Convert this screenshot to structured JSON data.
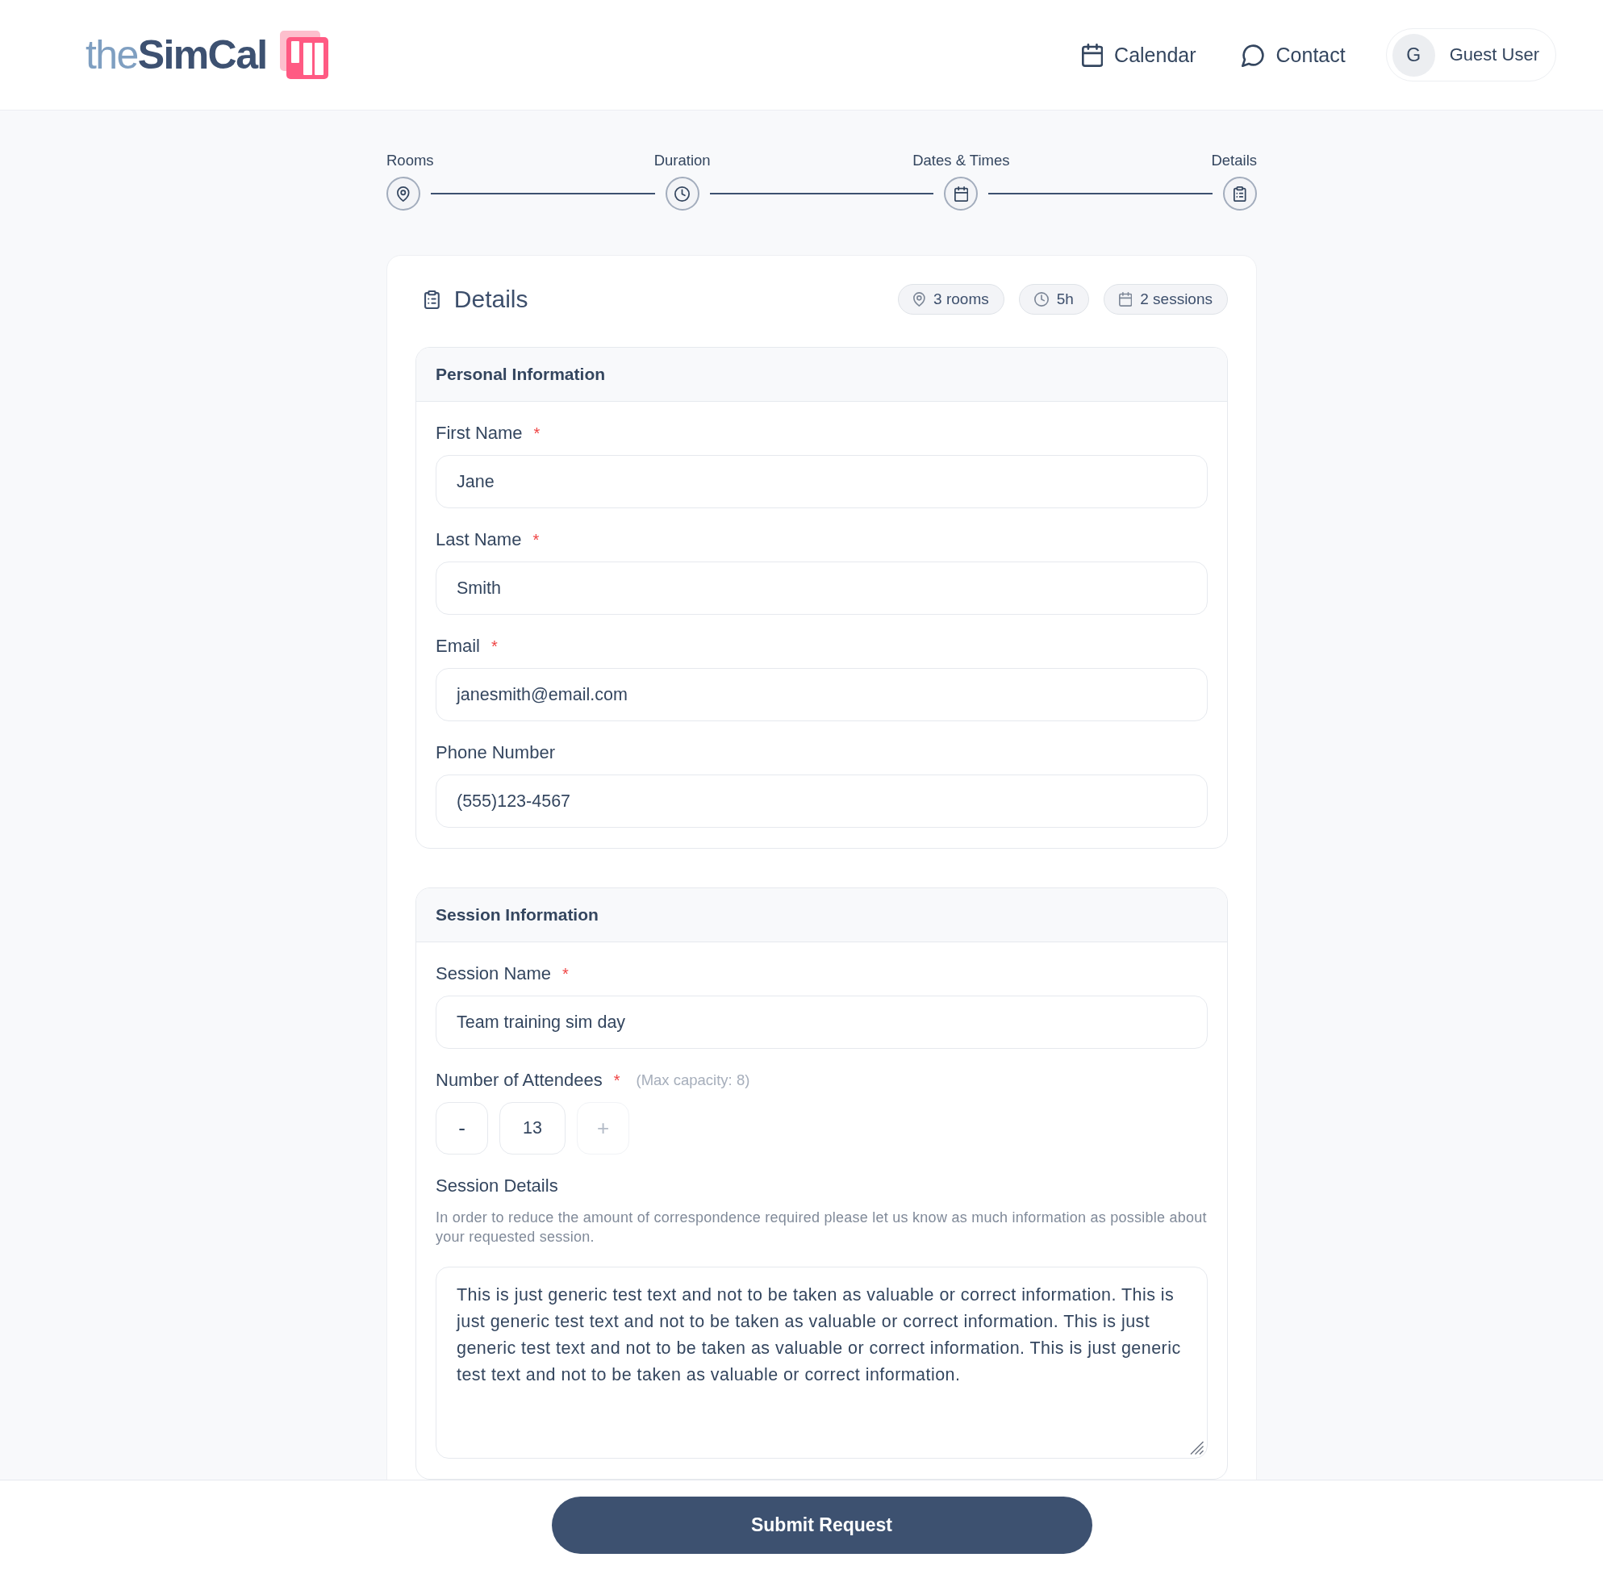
{
  "header": {
    "logo": "the**SimCal**",
    "nav": [
      {
        "label": "Calendar"
      },
      {
        "label": "Contact"
      }
    ],
    "user": {
      "avatar": "G",
      "name": "Guest User"
    }
  },
  "stepper": {
    "steps": [
      {
        "label": "Rooms"
      },
      {
        "label": "Duration"
      },
      {
        "label": "Dates & Times"
      },
      {
        "label": "Details"
      }
    ]
  },
  "card": {
    "title": "Details",
    "chips": [
      {
        "label": "3 rooms"
      },
      {
        "label": "5h"
      },
      {
        "label": "2 sessions"
      }
    ],
    "sections": [
      {
        "title": "Personal Information",
        "fields": [
          {
            "kind": "text",
            "label": "First Name",
            "required_mark": "*",
            "value": "Jane"
          },
          {
            "kind": "text",
            "label": "Last Name",
            "required_mark": "*",
            "value": "Smith"
          },
          {
            "kind": "text",
            "label": "Email",
            "required_mark": "*",
            "value": "janesmith@email.com"
          },
          {
            "kind": "text",
            "label": "Phone Number",
            "value": "(555)123-4567"
          }
        ]
      },
      {
        "title": "Session Information",
        "fields": [
          {
            "kind": "text",
            "label": "Session Name",
            "required_mark": "*",
            "value": "Team training sim day"
          },
          {
            "kind": "counter",
            "label": "Number of Attendees",
            "required_mark": "*",
            "hint": "(Max capacity: 8)",
            "decrement": {
              "label": "-",
              "disabled": false
            },
            "value": "13",
            "increment": {
              "label": "+",
              "disabled": true
            }
          },
          {
            "kind": "textarea",
            "label": "Session Details",
            "help": "In order to reduce the amount of correspondence required please let us know as much information as possible about your requested session.",
            "value": "This is just generic test text and not to be taken as valuable or correct information. This is just generic test text and not to be taken as valuable or correct information. This is just generic test text and not to be taken as valuable or correct information. This is just generic test text and not to be taken as valuable or correct information."
          }
        ]
      }
    ]
  },
  "footer": {
    "submit": "Submit Request"
  }
}
